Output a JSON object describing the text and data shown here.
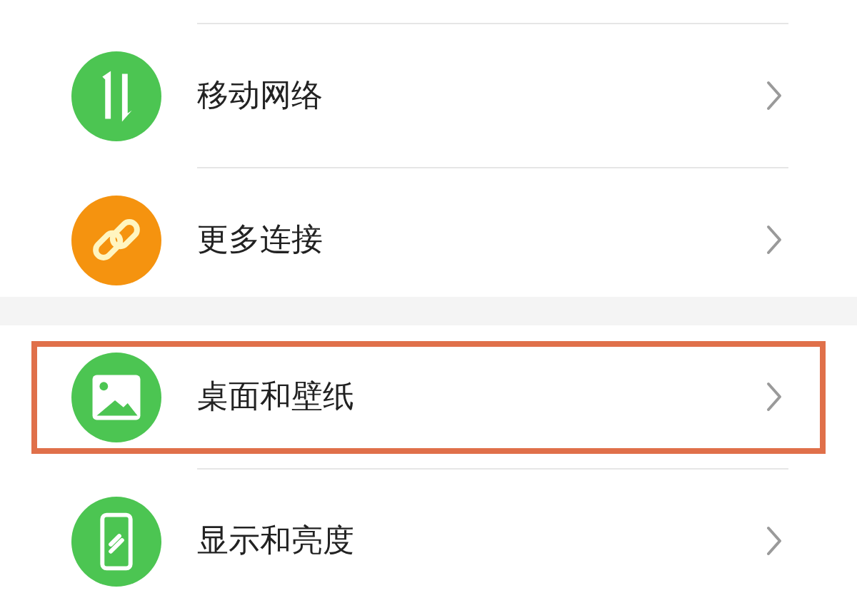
{
  "groups": [
    {
      "items": [
        {
          "label": "移动网络",
          "kind": "updown",
          "color": "#4cc552",
          "highlighted": false
        },
        {
          "label": "更多连接",
          "kind": "link",
          "color": "#f5930f",
          "highlighted": false
        }
      ]
    },
    {
      "items": [
        {
          "label": "桌面和壁纸",
          "kind": "image",
          "color": "#4cc552",
          "highlighted": true
        },
        {
          "label": "显示和亮度",
          "kind": "phone",
          "color": "#4cc552",
          "highlighted": false
        }
      ]
    }
  ]
}
